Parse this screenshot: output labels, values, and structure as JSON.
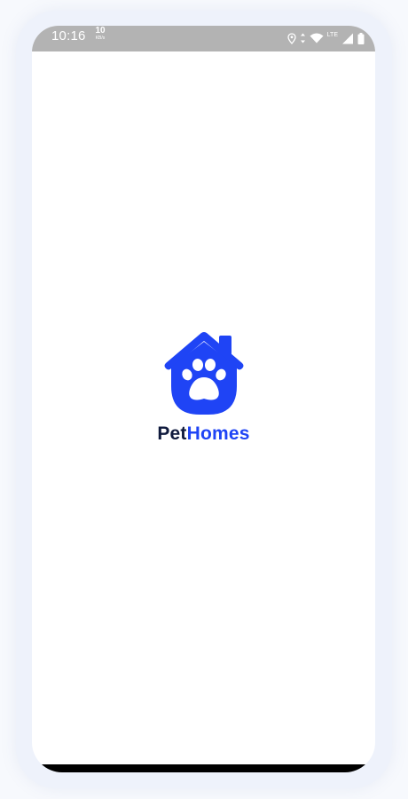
{
  "status_bar": {
    "time": "10:16",
    "net_speed_value": "10",
    "net_speed_unit": "KB/s",
    "network_type": "LTE",
    "icons": [
      "location-icon",
      "data-arrows-icon",
      "wifi-icon",
      "cell-signal-icon",
      "battery-icon"
    ]
  },
  "splash": {
    "logo_icon": "house-paw-icon",
    "brand_part_1": "Pet",
    "brand_part_2": "Homes"
  },
  "colors": {
    "brand_blue": "#1f44f5",
    "brand_dark": "#0f1a3d",
    "status_bar_bg": "#b3b3b3",
    "screen_bg": "#ffffff"
  }
}
